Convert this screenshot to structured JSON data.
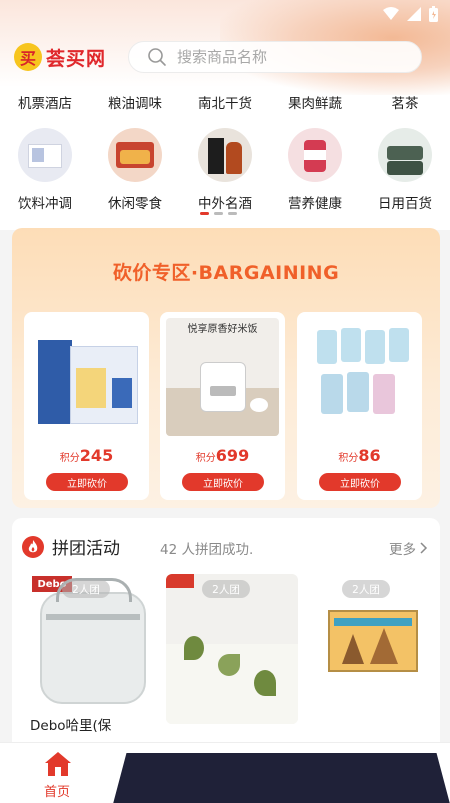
{
  "app": {
    "logo_glyph": "买",
    "name": "荟买网"
  },
  "search": {
    "placeholder": "搜索商品名称"
  },
  "categories_text": [
    "机票酒店",
    "粮油调味",
    "南北干货",
    "果肉鲜蔬",
    "茗茶"
  ],
  "categories_icon": [
    "饮料冲调",
    "休闲零食",
    "中外名酒",
    "营养健康",
    "日用百货"
  ],
  "bargain": {
    "title": "砍价专区·BARGAINING",
    "items": [
      {
        "points_label": "积分",
        "points": "245",
        "button": "立即砍价"
      },
      {
        "points_label": "积分",
        "points": "699",
        "button": "立即砍价",
        "banner_text": "悦享原香好米饭"
      },
      {
        "points_label": "积分",
        "points": "86",
        "button": "立即砍价"
      }
    ]
  },
  "group": {
    "title": "拼团活动",
    "subtitle": "42 人拼团成功.",
    "more": "更多",
    "items": [
      {
        "tag": "2人团",
        "name": "Debo哈里(保",
        "brand": "Debo"
      },
      {
        "tag": "2人团"
      },
      {
        "tag": "2人团"
      }
    ]
  },
  "nav": {
    "home_label": "首页"
  },
  "colors": {
    "accent": "#e2392b",
    "bargain_title": "#f0602a",
    "logo_yellow": "#f7c51e"
  }
}
